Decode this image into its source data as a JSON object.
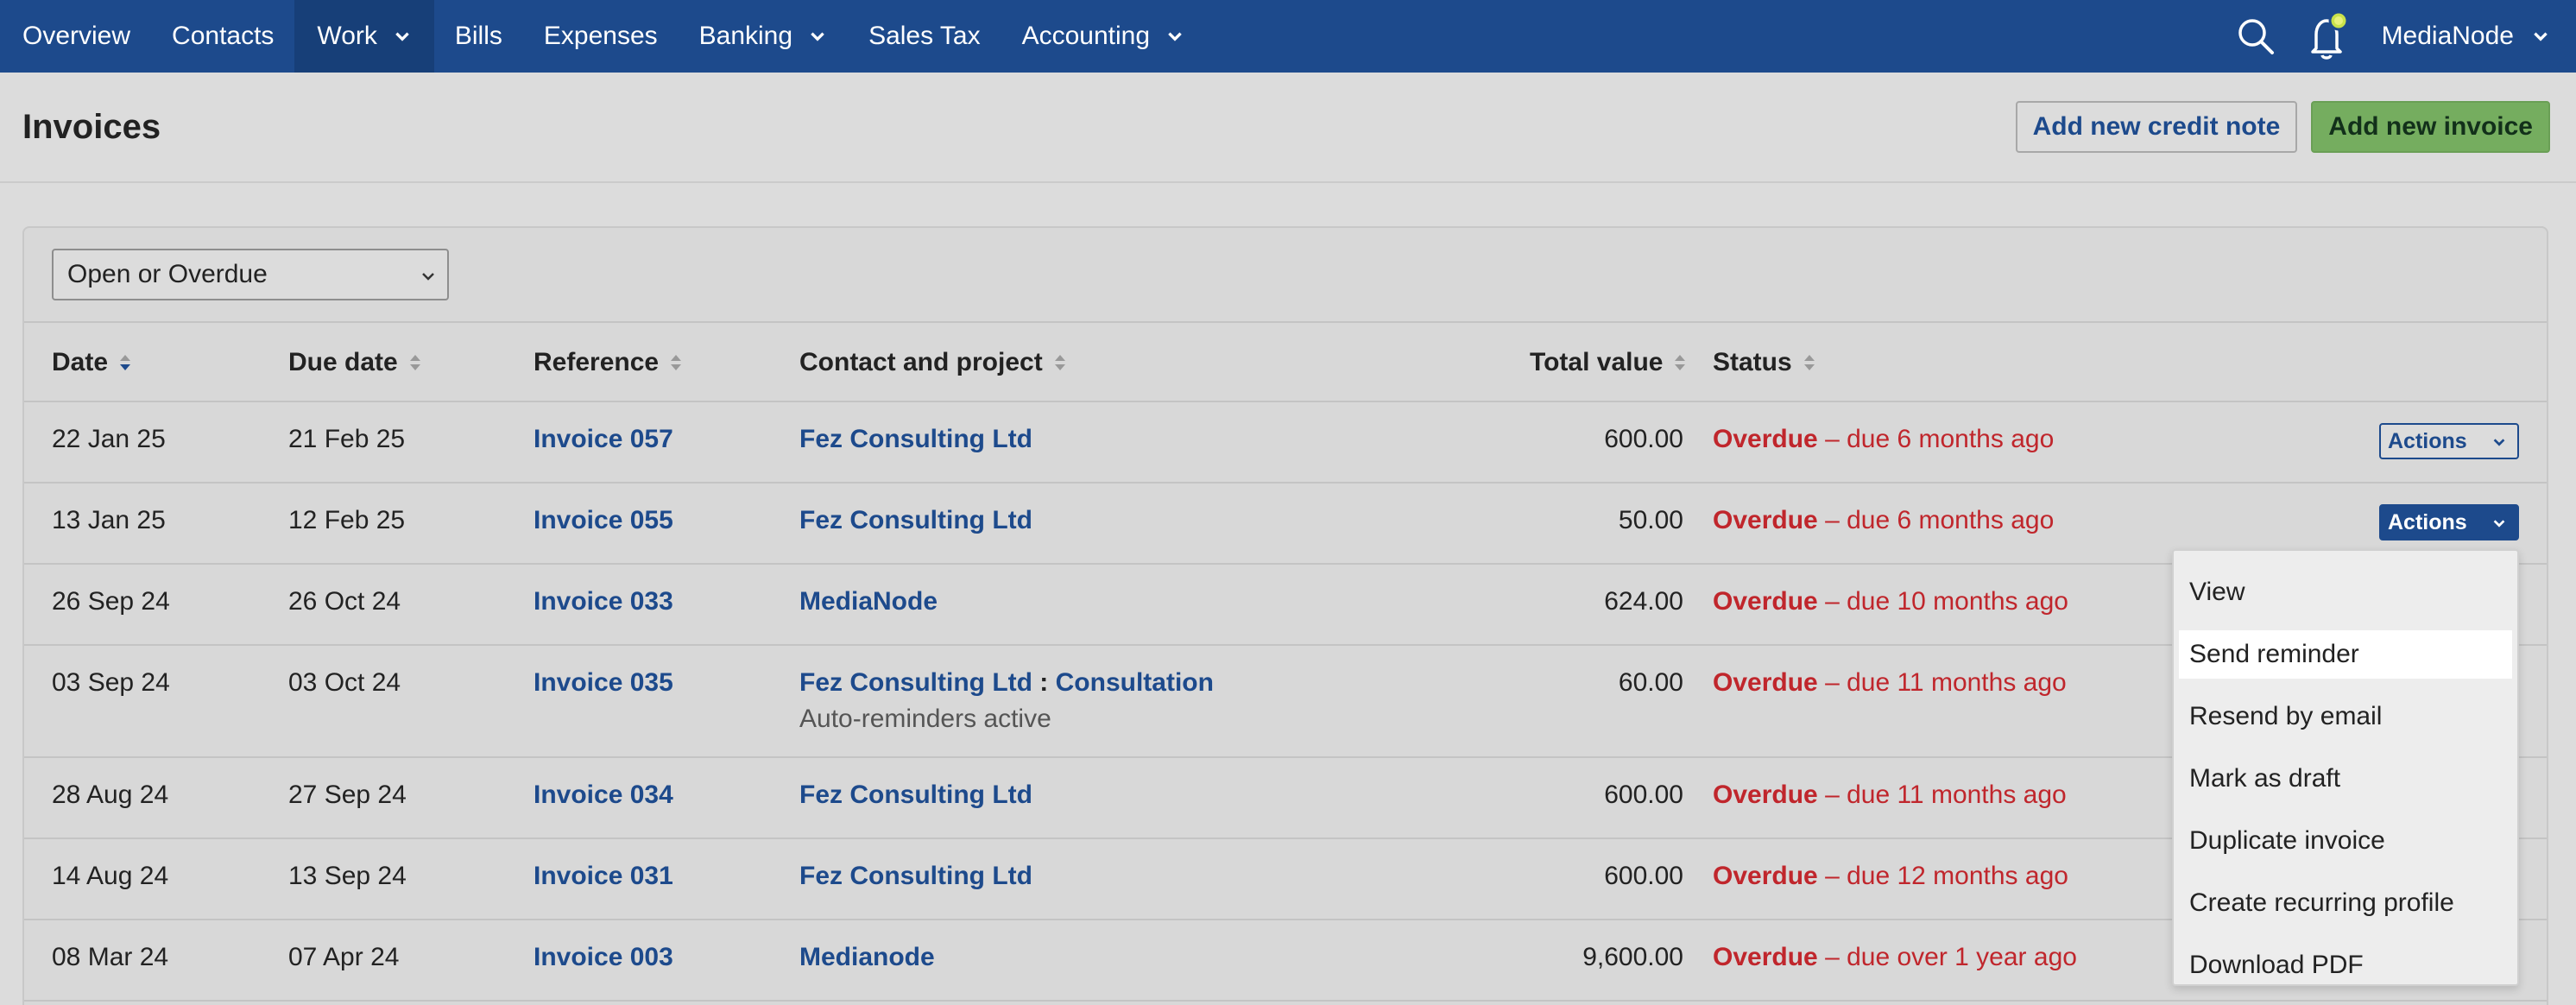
{
  "nav": {
    "items": [
      {
        "label": "Overview",
        "dropdown": false,
        "active": false
      },
      {
        "label": "Contacts",
        "dropdown": false,
        "active": false
      },
      {
        "label": "Work",
        "dropdown": true,
        "active": true
      },
      {
        "label": "Bills",
        "dropdown": false,
        "active": false
      },
      {
        "label": "Expenses",
        "dropdown": false,
        "active": false
      },
      {
        "label": "Banking",
        "dropdown": true,
        "active": false
      },
      {
        "label": "Sales Tax",
        "dropdown": false,
        "active": false
      },
      {
        "label": "Accounting",
        "dropdown": true,
        "active": false
      }
    ],
    "user": "MediaNode",
    "icons": [
      "search-icon",
      "bell-icon"
    ]
  },
  "header": {
    "title": "Invoices",
    "credit_note_label": "Add new credit note",
    "new_invoice_label": "Add new invoice"
  },
  "filter": {
    "selected": "Open or Overdue"
  },
  "table": {
    "columns": {
      "date": "Date",
      "due": "Due date",
      "reference": "Reference",
      "contact": "Contact and project",
      "total": "Total value",
      "status": "Status"
    },
    "rows": [
      {
        "date": "22 Jan 25",
        "due": "21 Feb 25",
        "reference": "Invoice 057",
        "contact": "Fez Consulting Ltd",
        "total": "600.00",
        "status_word": "Overdue",
        "status_rest": "– due 6 months ago"
      },
      {
        "date": "13 Jan 25",
        "due": "12 Feb 25",
        "reference": "Invoice 055",
        "contact": "Fez Consulting Ltd",
        "total": "50.00",
        "status_word": "Overdue",
        "status_rest": "– due 6 months ago"
      },
      {
        "date": "26 Sep 24",
        "due": "26 Oct 24",
        "reference": "Invoice 033",
        "contact": "MediaNode",
        "total": "624.00",
        "status_word": "Overdue",
        "status_rest": "– due 10 months ago"
      },
      {
        "date": "03 Sep 24",
        "due": "03 Oct 24",
        "reference": "Invoice 035",
        "contact": "Fez Consulting Ltd",
        "project_sep": " : ",
        "project": "Consultation",
        "note": "Auto-reminders active",
        "total": "60.00",
        "status_word": "Overdue",
        "status_rest": "– due 11 months ago"
      },
      {
        "date": "28 Aug 24",
        "due": "27 Sep 24",
        "reference": "Invoice 034",
        "contact": "Fez Consulting Ltd",
        "total": "600.00",
        "status_word": "Overdue",
        "status_rest": "– due 11 months ago"
      },
      {
        "date": "14 Aug 24",
        "due": "13 Sep 24",
        "reference": "Invoice 031",
        "contact": "Fez Consulting Ltd",
        "total": "600.00",
        "status_word": "Overdue",
        "status_rest": "– due 12 months ago"
      },
      {
        "date": "08 Mar 24",
        "due": "07 Apr 24",
        "reference": "Invoice 003",
        "contact": "Medianode",
        "total": "9,600.00",
        "status_word": "Overdue",
        "status_rest": "– due over 1 year ago"
      }
    ],
    "actions_label": "Actions"
  },
  "actions_menu": {
    "items": [
      "View",
      "Send reminder",
      "Resend by email",
      "Mark as draft",
      "Duplicate invoice",
      "Create recurring profile",
      "Download PDF"
    ],
    "highlighted": "Send reminder"
  },
  "colors": {
    "nav_bg": "#1d4a8c",
    "link": "#1d4a8c",
    "overdue": "#c0262c",
    "primary_button": "#75ad5f",
    "notification_dot": "#c9e24a"
  }
}
